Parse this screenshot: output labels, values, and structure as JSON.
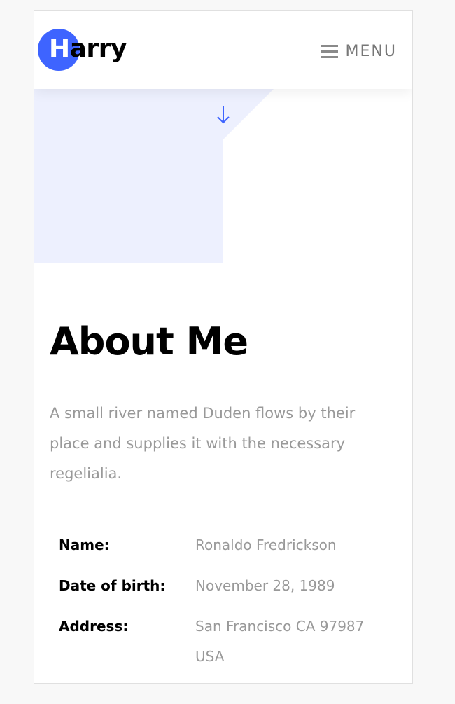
{
  "header": {
    "logo": {
      "first_letter": "H",
      "rest": "arry"
    },
    "menu": {
      "icon": "hamburger-icon",
      "label": "MENU"
    }
  },
  "hero": {
    "scroll_icon": "arrow-down-icon",
    "shape_color": "#edf0fe"
  },
  "about": {
    "title": "About Me",
    "text": "A small river named Duden flows by their place and supplies it with the necessary regelialia.",
    "info": [
      {
        "label": "Name:",
        "value": "Ronaldo Fredrickson"
      },
      {
        "label": "Date of birth:",
        "value": "November 28, 1989"
      },
      {
        "label": "Address:",
        "value": "San Francisco CA 97987 USA"
      }
    ]
  },
  "colors": {
    "accent": "#3e64ff",
    "text_dark": "#000000",
    "text_muted": "#999999",
    "page_background": "#f8f8f8"
  }
}
